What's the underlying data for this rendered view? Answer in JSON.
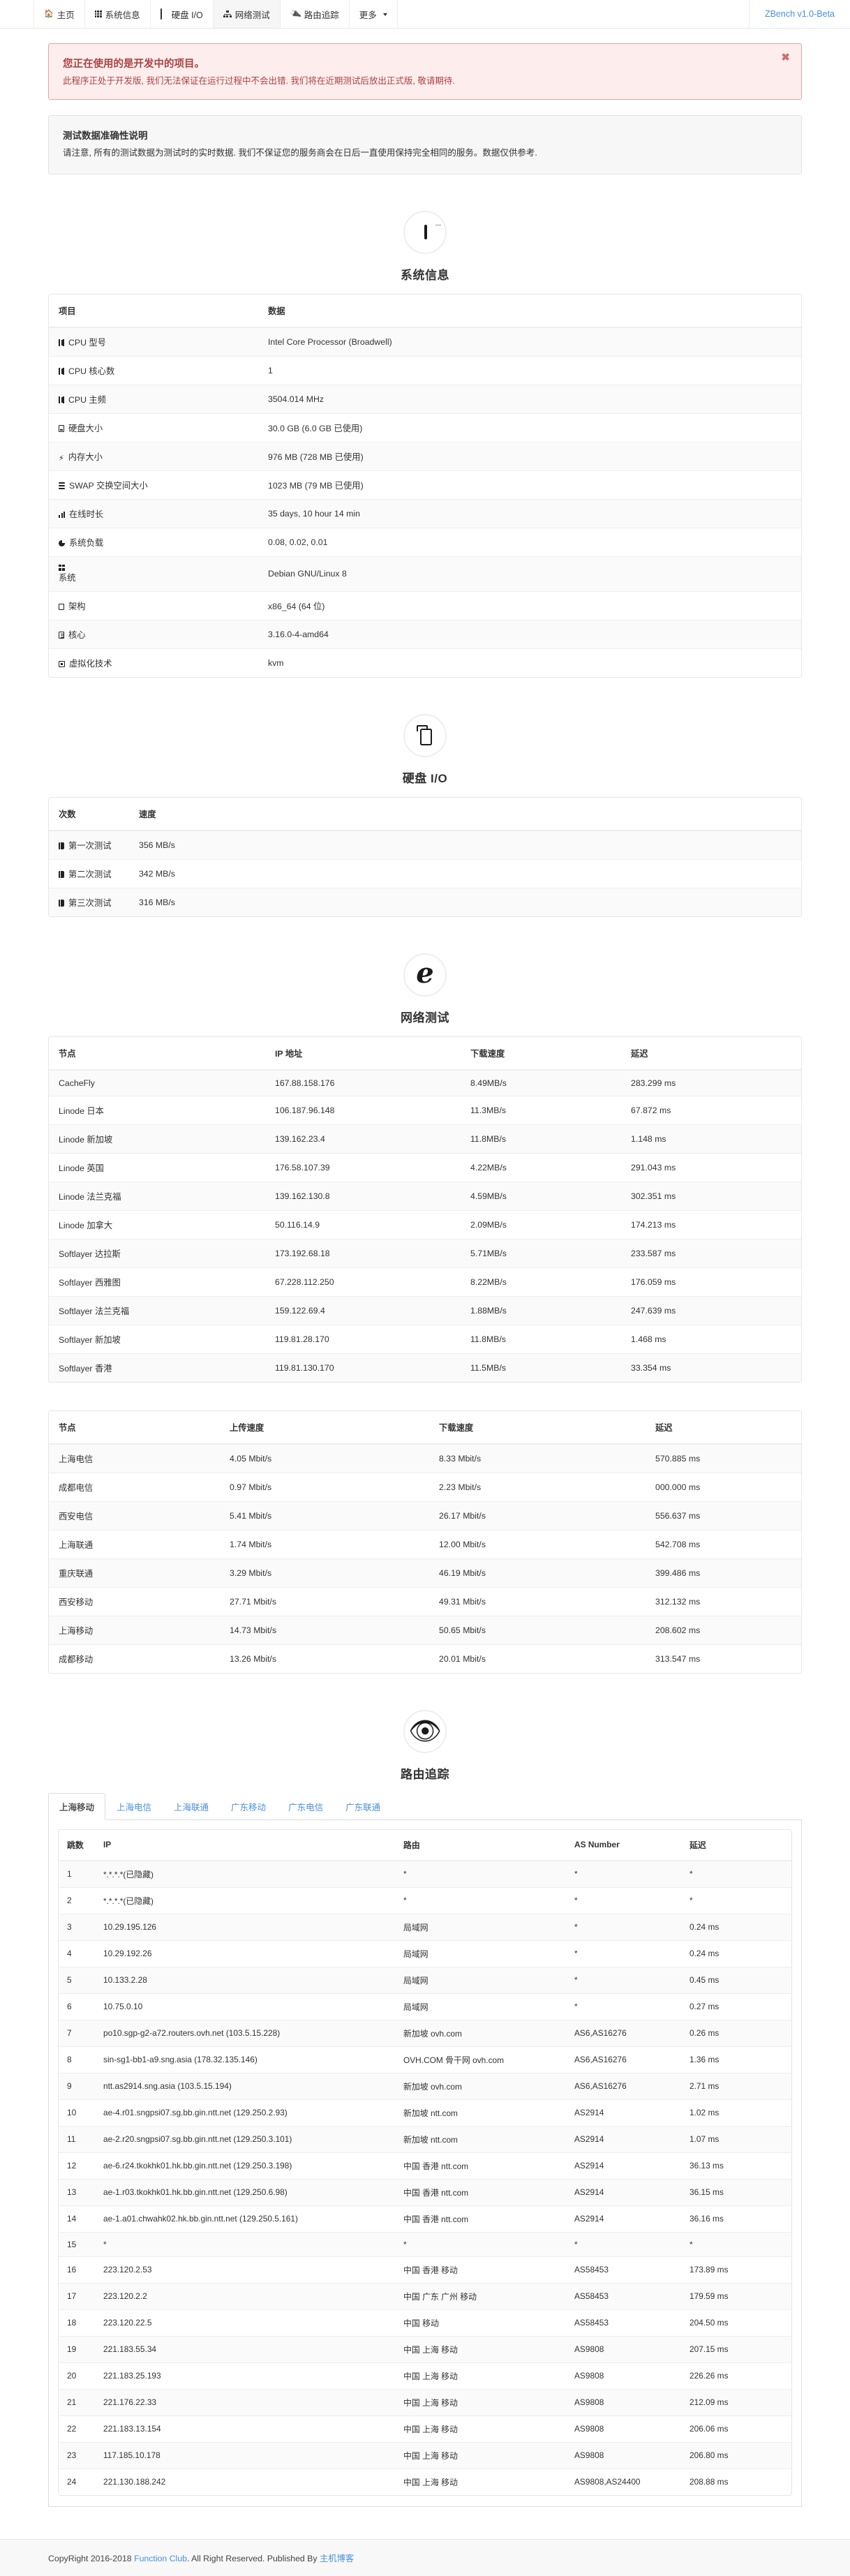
{
  "nav": {
    "items": [
      {
        "label": "主页",
        "icon": "home-icon",
        "active": false
      },
      {
        "label": "系统信息",
        "icon": "grid-icon",
        "active": false
      },
      {
        "label": "硬盘 I/O",
        "icon": "monitor-icon",
        "active": false
      },
      {
        "label": "网络测试",
        "icon": "sitemap-icon",
        "active": true
      },
      {
        "label": "路由追踪",
        "icon": "plug-icon",
        "active": false
      },
      {
        "label": "更多",
        "icon": "caret-down-icon",
        "active": false
      }
    ],
    "brand": "ZBench v1.0-Beta"
  },
  "alert": {
    "title": "您正在使用的是开发中的项目。",
    "text": "此程序正处于开发版, 我们无法保证在运行过程中不会出错. 我们将在近期测试后放出正式版, 敬请期待.",
    "close": "✖"
  },
  "notice": {
    "title": "测试数据准确性说明",
    "text": "请注意, 所有的测试数据为测试时的实时数据. 我们不保证您的服务商会在日后一直使用保持完全相同的服务。数据仅供参考."
  },
  "sysinfo": {
    "title": "系统信息",
    "icon": "laptop-icon",
    "headers": [
      "项目",
      "数据"
    ],
    "rows": [
      {
        "icon": "cpu-chip-icon",
        "label": "CPU 型号",
        "value": "Intel Core Processor (Broadwell)"
      },
      {
        "icon": "cpu-chip-icon",
        "label": "CPU 核心数",
        "value": "1"
      },
      {
        "icon": "cpu-chip-icon",
        "label": "CPU 主频",
        "value": "3504.014 MHz"
      },
      {
        "icon": "hdd-icon",
        "label": "硬盘大小",
        "value": "30.0 GB (6.0 GB 已使用)"
      },
      {
        "icon": "bolt-icon",
        "label": "内存大小",
        "value": "976 MB (728 MB 已使用)"
      },
      {
        "icon": "stack-icon",
        "label": "SWAP 交换空间大小",
        "value": "1023 MB (79 MB 已使用)"
      },
      {
        "icon": "chart-icon",
        "label": "在线时长",
        "value": "35 days, 10 hour 14 min"
      },
      {
        "icon": "pie-icon",
        "label": "系统负载",
        "value": "0.08, 0.02, 0.01"
      },
      {
        "icon": "windows-icon",
        "label": "系统",
        "value": "Debian GNU/Linux 8"
      },
      {
        "icon": "square-icon",
        "label": "架构",
        "value": "x86_64 (64 位)"
      },
      {
        "icon": "file-icon",
        "label": "核心",
        "value": "3.16.0-4-amd64"
      },
      {
        "icon": "vm-icon",
        "label": "虚拟化技术",
        "value": "kvm"
      }
    ]
  },
  "diskio": {
    "title": "硬盘 I/O",
    "icon": "copy-disk-icon",
    "headers": [
      "次数",
      "速度"
    ],
    "rows": [
      {
        "icon": "book-icon",
        "label": "第一次测试",
        "value": "356 MB/s"
      },
      {
        "icon": "book-icon",
        "label": "第二次测试",
        "value": "342 MB/s"
      },
      {
        "icon": "book-icon",
        "label": "第三次测试",
        "value": "316 MB/s"
      }
    ]
  },
  "nettest": {
    "title": "网络测试",
    "icon": "ie-browser-icon",
    "intl": {
      "headers": [
        "节点",
        "IP 地址",
        "下载速度",
        "延迟"
      ],
      "rows": [
        [
          "CacheFly",
          "167.88.158.176",
          "8.49MB/s",
          "283.299 ms"
        ],
        [
          "Linode 日本",
          "106.187.96.148",
          "11.3MB/s",
          "67.872 ms"
        ],
        [
          "Linode 新加坡",
          "139.162.23.4",
          "11.8MB/s",
          "1.148 ms"
        ],
        [
          "Linode 英国",
          "176.58.107.39",
          "4.22MB/s",
          "291.043 ms"
        ],
        [
          "Linode 法兰克福",
          "139.162.130.8",
          "4.59MB/s",
          "302.351 ms"
        ],
        [
          "Linode 加拿大",
          "50.116.14.9",
          "2.09MB/s",
          "174.213 ms"
        ],
        [
          "Softlayer 达拉斯",
          "173.192.68.18",
          "5.71MB/s",
          "233.587 ms"
        ],
        [
          "Softlayer 西雅图",
          "67.228.112.250",
          "8.22MB/s",
          "176.059 ms"
        ],
        [
          "Softlayer 法兰克福",
          "159.122.69.4",
          "1.88MB/s",
          "247.639 ms"
        ],
        [
          "Softlayer 新加坡",
          "119.81.28.170",
          "11.8MB/s",
          "1.468 ms"
        ],
        [
          "Softlayer 香港",
          "119.81.130.170",
          "11.5MB/s",
          "33.354 ms"
        ]
      ]
    },
    "cn": {
      "headers": [
        "节点",
        "上传速度",
        "下载速度",
        "延迟"
      ],
      "rows": [
        [
          "上海电信",
          "4.05 Mbit/s",
          "8.33 Mbit/s",
          "570.885 ms"
        ],
        [
          "成都电信",
          "0.97 Mbit/s",
          "2.23 Mbit/s",
          "000.000 ms"
        ],
        [
          "西安电信",
          "5.41 Mbit/s",
          "26.17 Mbit/s",
          "556.637 ms"
        ],
        [
          "上海联通",
          "1.74 Mbit/s",
          "12.00 Mbit/s",
          "542.708 ms"
        ],
        [
          "重庆联通",
          "3.29 Mbit/s",
          "46.19 Mbit/s",
          "399.486 ms"
        ],
        [
          "西安移动",
          "27.71 Mbit/s",
          "49.31 Mbit/s",
          "312.132 ms"
        ],
        [
          "上海移动",
          "14.73 Mbit/s",
          "50.65 Mbit/s",
          "208.602 ms"
        ],
        [
          "成都移动",
          "13.26 Mbit/s",
          "20.01 Mbit/s",
          "313.547 ms"
        ]
      ]
    }
  },
  "trace": {
    "title": "路由追踪",
    "icon": "blind-walk-icon",
    "tabs": [
      "上海移动",
      "上海电信",
      "上海联通",
      "广东移动",
      "广东电信",
      "广东联通"
    ],
    "active_tab": 0,
    "headers": [
      "跳数",
      "IP",
      "路由",
      "AS Number",
      "延迟"
    ],
    "rows": [
      [
        "1",
        "*.*.*.*(已隐藏)",
        "*",
        "*",
        "*"
      ],
      [
        "2",
        "*.*.*.*(已隐藏)",
        "*",
        "*",
        "*"
      ],
      [
        "3",
        "10.29.195.126",
        "局域网",
        "*",
        "0.24 ms"
      ],
      [
        "4",
        "10.29.192.26",
        "局域网",
        "*",
        "0.24 ms"
      ],
      [
        "5",
        "10.133.2.28",
        "局域网",
        "*",
        "0.45 ms"
      ],
      [
        "6",
        "10.75.0.10",
        "局域网",
        "*",
        "0.27 ms"
      ],
      [
        "7",
        "po10.sgp-g2-a72.routers.ovh.net (103.5.15.228)",
        "新加坡 ovh.com",
        "AS6,AS16276",
        "0.26 ms"
      ],
      [
        "8",
        "sin-sg1-bb1-a9.sng.asia (178.32.135.146)",
        "OVH.COM 骨干网 ovh.com",
        "AS6,AS16276",
        "1.36 ms"
      ],
      [
        "9",
        "ntt.as2914.sng.asia (103.5.15.194)",
        "新加坡 ovh.com",
        "AS6,AS16276",
        "2.71 ms"
      ],
      [
        "10",
        "ae-4.r01.sngpsi07.sg.bb.gin.ntt.net (129.250.2.93)",
        "新加坡 ntt.com",
        "AS2914",
        "1.02 ms"
      ],
      [
        "11",
        "ae-2.r20.sngpsi07.sg.bb.gin.ntt.net (129.250.3.101)",
        "新加坡 ntt.com",
        "AS2914",
        "1.07 ms"
      ],
      [
        "12",
        "ae-6.r24.tkokhk01.hk.bb.gin.ntt.net (129.250.3.198)",
        "中国 香港 ntt.com",
        "AS2914",
        "36.13 ms"
      ],
      [
        "13",
        "ae-1.r03.tkokhk01.hk.bb.gin.ntt.net (129.250.6.98)",
        "中国 香港 ntt.com",
        "AS2914",
        "36.15 ms"
      ],
      [
        "14",
        "ae-1.a01.chwahk02.hk.bb.gin.ntt.net (129.250.5.161)",
        "中国 香港 ntt.com",
        "AS2914",
        "36.16 ms"
      ],
      [
        "15",
        "*",
        "*",
        "*",
        "*"
      ],
      [
        "16",
        "223.120.2.53",
        "中国 香港 移动",
        "AS58453",
        "173.89 ms"
      ],
      [
        "17",
        "223.120.2.2",
        "中国 广东 广州 移动",
        "AS58453",
        "179.59 ms"
      ],
      [
        "18",
        "223.120.22.5",
        "中国 移动",
        "AS58453",
        "204.50 ms"
      ],
      [
        "19",
        "221.183.55.34",
        "中国 上海 移动",
        "AS9808",
        "207.15 ms"
      ],
      [
        "20",
        "221.183.25.193",
        "中国 上海 移动",
        "AS9808",
        "226.26 ms"
      ],
      [
        "21",
        "221.176.22.33",
        "中国 上海 移动",
        "AS9808",
        "212.09 ms"
      ],
      [
        "22",
        "221.183.13.154",
        "中国 上海 移动",
        "AS9808",
        "206.06 ms"
      ],
      [
        "23",
        "117.185.10.178",
        "中国 上海 移动",
        "AS9808",
        "206.80 ms"
      ],
      [
        "24",
        "221.130.188.242",
        "中国 上海 移动",
        "AS9808,AS24400",
        "208.88 ms"
      ]
    ]
  },
  "footer": {
    "prefix": "CopyRight 2016-2018 ",
    "link1": "Function Club",
    "middle": ". All Right Reserved. Published By ",
    "link2": "主机博客"
  },
  "colors": {
    "link": "#4a90d9",
    "alert_bg": "#fdeded",
    "alert_border": "#e2a5a5",
    "alert_text": "#a94442"
  }
}
